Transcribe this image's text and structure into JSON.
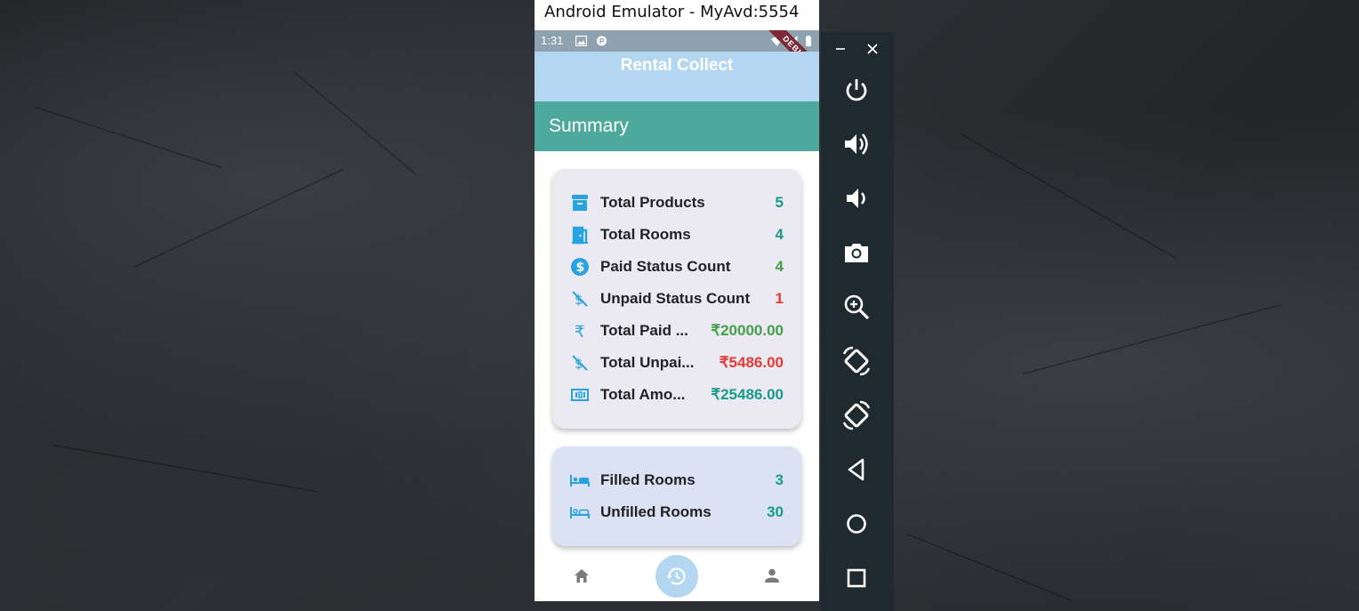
{
  "window": {
    "title": "Android Emulator - MyAvd:5554"
  },
  "status_bar": {
    "time": "1:31",
    "debug_banner": "DEBUG"
  },
  "app": {
    "title": "Rental Collect"
  },
  "summary_header": {
    "title": "Summary"
  },
  "summary_card": {
    "rows": [
      {
        "icon": "inventory-box-icon",
        "label": "Total Products",
        "value": "5",
        "value_color": "#1a9a8a"
      },
      {
        "icon": "door-icon",
        "label": "Total Rooms",
        "value": "4",
        "value_color": "#1a9a8a"
      },
      {
        "icon": "dollar-circle-icon",
        "label": "Paid Status Count",
        "value": "4",
        "value_color": "#43a047"
      },
      {
        "icon": "money-off-icon",
        "label": "Unpaid Status Count",
        "value": "1",
        "value_color": "#e53935"
      },
      {
        "icon": "rupee-icon",
        "label": "Total Paid ...",
        "value": "₹20000.00",
        "value_color": "#43a047"
      },
      {
        "icon": "money-off-icon",
        "label": "Total Unpai...",
        "value": "₹5486.00",
        "value_color": "#e53935"
      },
      {
        "icon": "money-icon",
        "label": "Total Amo...",
        "value": "₹25486.00",
        "value_color": "#1a9a8a"
      }
    ]
  },
  "rooms_card": {
    "rows": [
      {
        "icon": "bed-filled-icon",
        "label": "Filled Rooms",
        "value": "3",
        "value_color": "#1a9a8a"
      },
      {
        "icon": "bed-outline-icon",
        "label": "Unfilled Rooms",
        "value": "30",
        "value_color": "#1a9a8a"
      }
    ]
  },
  "bottom_nav": {
    "items": [
      "home-icon",
      "history-icon",
      "person-icon"
    ]
  },
  "toolbar": {
    "buttons": [
      "minimize-icon",
      "close-icon",
      "power-icon",
      "volume-up-icon",
      "volume-down-icon",
      "camera-icon",
      "zoom-icon",
      "rotate-left-icon",
      "rotate-right-icon",
      "back-icon",
      "home-circle-icon",
      "overview-icon"
    ]
  },
  "colors": {
    "accent_teal": "#4ea99d",
    "app_bar": "#b3d6f1",
    "icon_blue": "#29a3e0"
  }
}
